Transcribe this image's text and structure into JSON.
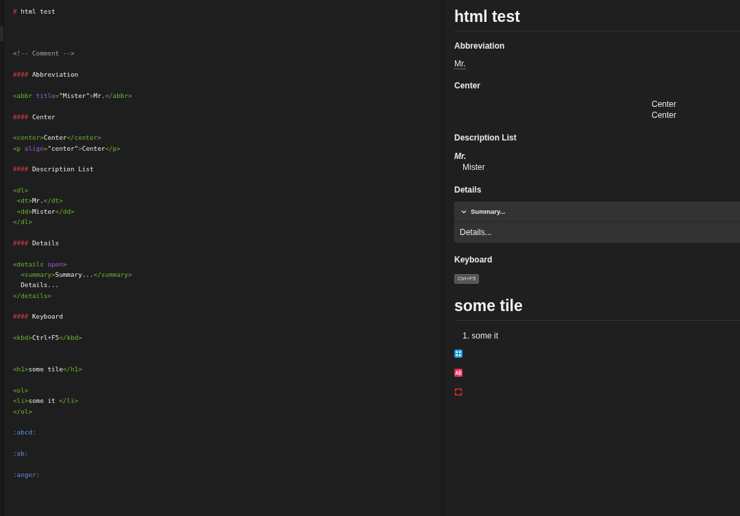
{
  "editor": {
    "lines": [
      {
        "kind": "code",
        "tokens": [
          {
            "kind": "mark",
            "text": "#"
          },
          {
            "kind": "text",
            "text": " html test"
          }
        ]
      },
      {
        "kind": "blank"
      },
      {
        "kind": "blank"
      },
      {
        "kind": "blank"
      },
      {
        "kind": "code",
        "tokens": [
          {
            "kind": "comment",
            "text": "<!-- Comment -->"
          }
        ]
      },
      {
        "kind": "blank"
      },
      {
        "kind": "code",
        "tokens": [
          {
            "kind": "mark",
            "text": "####"
          },
          {
            "kind": "text",
            "text": " Abbreviation"
          }
        ]
      },
      {
        "kind": "blank"
      },
      {
        "kind": "code",
        "tokens": [
          {
            "kind": "tag",
            "text": "<abbr "
          },
          {
            "kind": "attr",
            "text": "title"
          },
          {
            "kind": "tag",
            "text": "="
          },
          {
            "kind": "text",
            "text": "\"Mister\""
          },
          {
            "kind": "tag",
            "text": ">"
          },
          {
            "kind": "text",
            "text": "Mr."
          },
          {
            "kind": "tag",
            "text": "</abbr>"
          }
        ]
      },
      {
        "kind": "blank"
      },
      {
        "kind": "code",
        "tokens": [
          {
            "kind": "mark",
            "text": "####"
          },
          {
            "kind": "text",
            "text": " Center"
          }
        ]
      },
      {
        "kind": "blank"
      },
      {
        "kind": "code",
        "tokens": [
          {
            "kind": "tag",
            "text": "<center>"
          },
          {
            "kind": "text",
            "text": "Center"
          },
          {
            "kind": "tag",
            "text": "</center>"
          }
        ]
      },
      {
        "kind": "code",
        "tokens": [
          {
            "kind": "tag",
            "text": "<p "
          },
          {
            "kind": "attr",
            "text": "align"
          },
          {
            "kind": "tag",
            "text": "="
          },
          {
            "kind": "text",
            "text": "\"center\""
          },
          {
            "kind": "tag",
            "text": ">"
          },
          {
            "kind": "text",
            "text": "Center"
          },
          {
            "kind": "tag",
            "text": "</p>"
          }
        ]
      },
      {
        "kind": "blank"
      },
      {
        "kind": "code",
        "tokens": [
          {
            "kind": "mark",
            "text": "####"
          },
          {
            "kind": "text",
            "text": " Description List"
          }
        ]
      },
      {
        "kind": "blank"
      },
      {
        "kind": "code",
        "tokens": [
          {
            "kind": "tag",
            "text": "<dl>"
          }
        ]
      },
      {
        "kind": "code",
        "tokens": [
          {
            "kind": "tag",
            "text": " <dt>"
          },
          {
            "kind": "text",
            "text": "Mr."
          },
          {
            "kind": "tag",
            "text": "</dt>"
          }
        ]
      },
      {
        "kind": "code",
        "tokens": [
          {
            "kind": "tag",
            "text": " <dd>"
          },
          {
            "kind": "text",
            "text": "Mister"
          },
          {
            "kind": "tag",
            "text": "</dd>"
          }
        ]
      },
      {
        "kind": "code",
        "tokens": [
          {
            "kind": "tag",
            "text": "</dl>"
          }
        ]
      },
      {
        "kind": "blank"
      },
      {
        "kind": "code",
        "tokens": [
          {
            "kind": "mark",
            "text": "####"
          },
          {
            "kind": "text",
            "text": " Details"
          }
        ]
      },
      {
        "kind": "blank"
      },
      {
        "kind": "code",
        "tokens": [
          {
            "kind": "tag",
            "text": "<details "
          },
          {
            "kind": "attr",
            "text": "open"
          },
          {
            "kind": "tag",
            "text": ">"
          }
        ]
      },
      {
        "kind": "code",
        "tokens": [
          {
            "kind": "tag",
            "text": "  <summary>"
          },
          {
            "kind": "text",
            "text": "Summary..."
          },
          {
            "kind": "tag",
            "text": "</summary>"
          }
        ]
      },
      {
        "kind": "code",
        "tokens": [
          {
            "kind": "text",
            "text": "  Details..."
          }
        ]
      },
      {
        "kind": "code",
        "tokens": [
          {
            "kind": "tag",
            "text": "</details>"
          }
        ]
      },
      {
        "kind": "blank"
      },
      {
        "kind": "code",
        "tokens": [
          {
            "kind": "mark",
            "text": "####"
          },
          {
            "kind": "text",
            "text": " Keyboard"
          }
        ]
      },
      {
        "kind": "blank"
      },
      {
        "kind": "code",
        "tokens": [
          {
            "kind": "tag",
            "text": "<kbd>"
          },
          {
            "kind": "text",
            "text": "Ctrl+F5"
          },
          {
            "kind": "tag",
            "text": "</kbd>"
          }
        ]
      },
      {
        "kind": "blank"
      },
      {
        "kind": "blank"
      },
      {
        "kind": "code",
        "tokens": [
          {
            "kind": "tag",
            "text": "<h1>"
          },
          {
            "kind": "text",
            "text": "some tile"
          },
          {
            "kind": "tag",
            "text": "</h1>"
          }
        ]
      },
      {
        "kind": "blank"
      },
      {
        "kind": "code",
        "tokens": [
          {
            "kind": "tag",
            "text": "<ol>"
          }
        ]
      },
      {
        "kind": "code",
        "tokens": [
          {
            "kind": "tag",
            "text": "<li>"
          },
          {
            "kind": "text",
            "text": "some it "
          },
          {
            "kind": "tag",
            "text": "</li>"
          }
        ]
      },
      {
        "kind": "code",
        "tokens": [
          {
            "kind": "tag",
            "text": "</ol>"
          }
        ]
      },
      {
        "kind": "blank"
      },
      {
        "kind": "code",
        "tokens": [
          {
            "kind": "emoji",
            "text": ":abcd:"
          }
        ]
      },
      {
        "kind": "blank"
      },
      {
        "kind": "code",
        "tokens": [
          {
            "kind": "emoji",
            "text": ":ab:"
          }
        ]
      },
      {
        "kind": "blank"
      },
      {
        "kind": "code",
        "tokens": [
          {
            "kind": "emoji",
            "text": ":anger:"
          }
        ]
      }
    ]
  },
  "preview": {
    "blocks": [
      {
        "kind": "h1",
        "text": "html test"
      },
      {
        "kind": "h4",
        "text": "Abbreviation"
      },
      {
        "kind": "abbr",
        "text": "Mr."
      },
      {
        "kind": "h4",
        "text": "Center"
      },
      {
        "kind": "center",
        "texts": [
          "Center",
          "Center"
        ]
      },
      {
        "kind": "h4",
        "text": "Description List"
      },
      {
        "kind": "dl",
        "term": "Mr.",
        "definition": "Mister"
      },
      {
        "kind": "h4",
        "text": "Details"
      },
      {
        "kind": "details",
        "summary": "Summary...",
        "body": "Details...",
        "expanded": true
      },
      {
        "kind": "h4",
        "text": "Keyboard"
      },
      {
        "kind": "kbd",
        "text": "Ctrl+F5"
      },
      {
        "kind": "h1",
        "text": "some tile"
      },
      {
        "kind": "ol",
        "items": [
          {
            "number": "1.",
            "text": "some it"
          }
        ]
      },
      {
        "kind": "gridemoji",
        "color": "#1a9ee2"
      },
      {
        "kind": "tagemoji",
        "color": "#e8295a"
      },
      {
        "kind": "angeremoji",
        "color": "#e22a2a"
      }
    ]
  }
}
